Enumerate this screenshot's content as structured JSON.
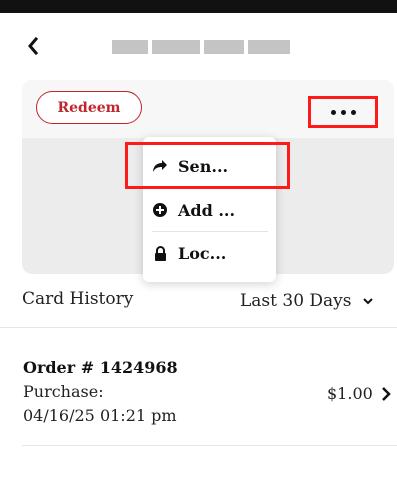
{
  "header": {
    "back_icon": "chevron-left-icon",
    "title_redacted": true
  },
  "card": {
    "redeem_label": "Redeem",
    "more_icon": "ellipsis-horizontal-icon"
  },
  "menu": {
    "items": [
      {
        "label": "Sen...",
        "icon": "share-arrow-icon"
      },
      {
        "label": "Add ...",
        "icon": "plus-circle-icon"
      },
      {
        "label": "Loc...",
        "icon": "lock-icon"
      }
    ]
  },
  "history": {
    "label": "Card History",
    "range": "Last 30 Days",
    "range_icon": "chevron-down-icon"
  },
  "orders": [
    {
      "title": "Order # 1424968",
      "type": "Purchase:",
      "date": "04/16/25 01:21 pm",
      "amount": "$1.00"
    }
  ],
  "colors": {
    "accent": "#c0262d",
    "highlight": "#ff1a1a"
  }
}
